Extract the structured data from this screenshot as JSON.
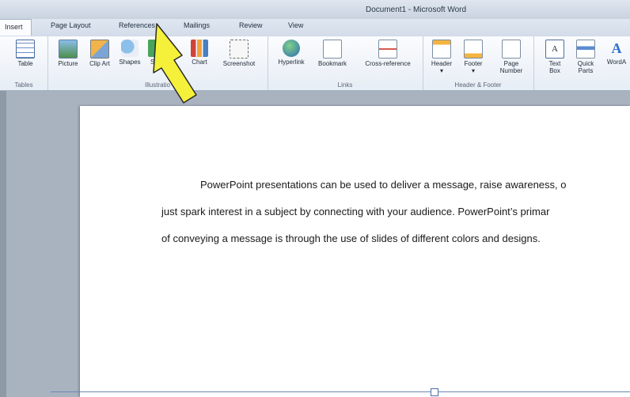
{
  "window": {
    "title": "Document1 - Microsoft Word"
  },
  "tabs": [
    {
      "label": "Insert"
    },
    {
      "label": "Page Layout"
    },
    {
      "label": "References"
    },
    {
      "label": "Mailings"
    },
    {
      "label": "Review"
    },
    {
      "label": "View"
    }
  ],
  "ribbon": {
    "groups": {
      "tables": "Tables",
      "illustrations": "Illustratio",
      "links": "Links",
      "header_footer": "Header & Footer"
    },
    "buttons": {
      "table": "Table",
      "picture": "Picture",
      "clip_art": "Clip Art",
      "shapes": "Shapes",
      "smartart": "Sm",
      "chart": "Chart",
      "screenshot": "Screenshot",
      "hyperlink": "Hyperlink",
      "bookmark": "Bookmark",
      "cross_reference": "Cross-reference",
      "header": "Header",
      "footer": "Footer",
      "page_number": "Page Number",
      "text_box": "Text Box",
      "quick_parts": "Quick Parts",
      "wordart": "WordA"
    }
  },
  "document": {
    "lines": [
      "PowerPoint presentations can be used to deliver a message, raise awareness, o",
      "just spark interest in a subject by connecting with your audience. PowerPoint’s primar",
      "of conveying a message is through the use of slides of different colors and designs."
    ]
  },
  "colors": {
    "accent": "#2b579a",
    "arrow": "#f5f13a",
    "ribbon": "#f4f7fb"
  }
}
